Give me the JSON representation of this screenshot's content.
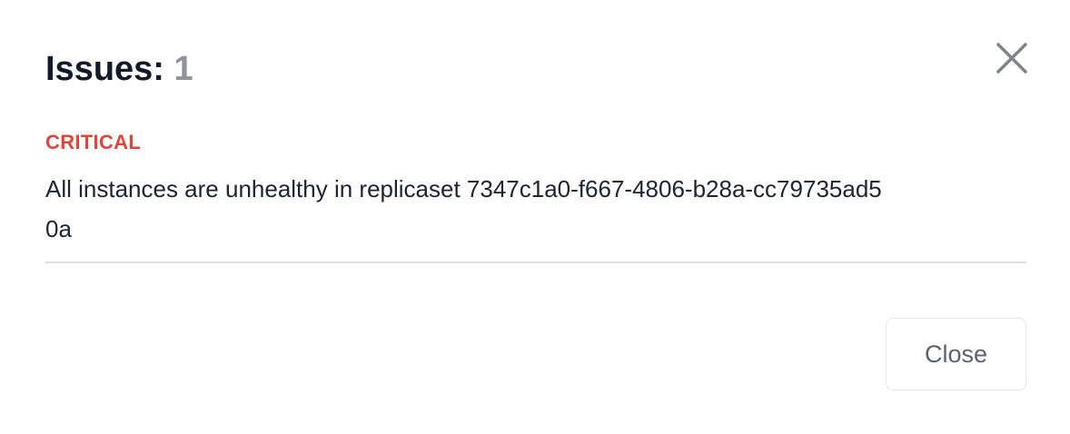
{
  "dialog": {
    "title_label": "Issues:",
    "title_count": "1",
    "close_icon": "close-icon",
    "close_button_label": "Close"
  },
  "issues": [
    {
      "severity": "CRITICAL",
      "message": "All instances are unhealthy in replicaset 7347c1a0-f667-4806-b28a-cc79735ad50a"
    }
  ],
  "colors": {
    "critical": "#e0463a",
    "title": "#141a29",
    "count": "#8e939c",
    "divider": "#dcdee2"
  }
}
